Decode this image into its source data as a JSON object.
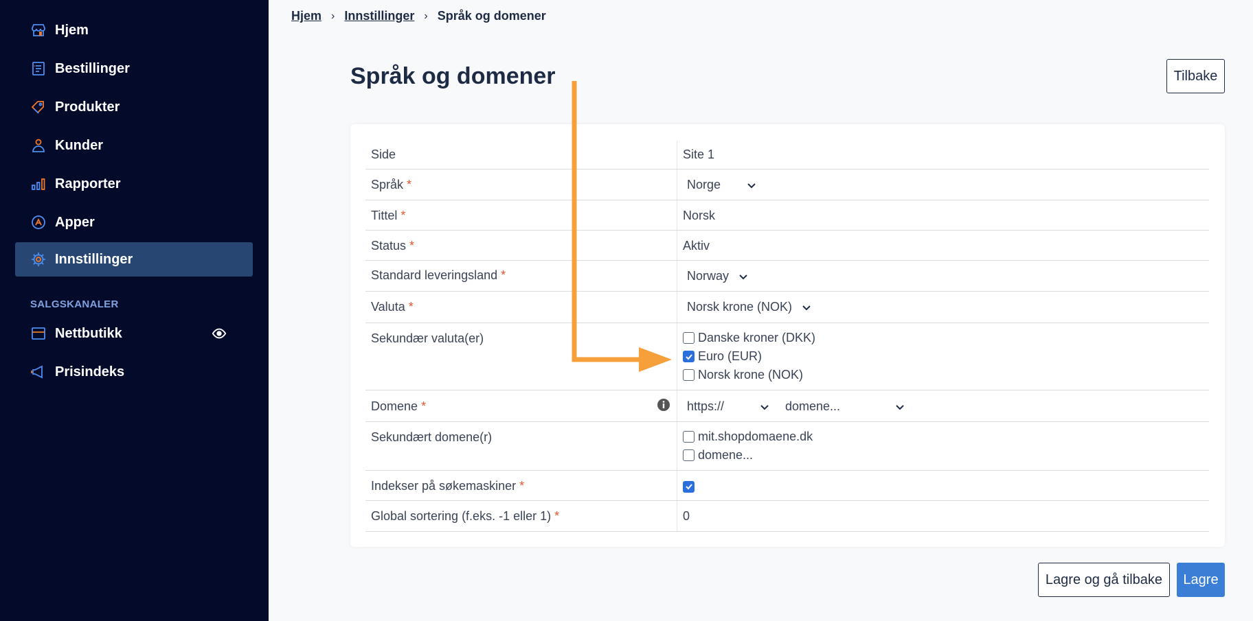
{
  "sidebar": {
    "items": [
      {
        "label": "Hjem",
        "icon": "store-icon"
      },
      {
        "label": "Bestillinger",
        "icon": "orders-icon"
      },
      {
        "label": "Produkter",
        "icon": "tag-icon"
      },
      {
        "label": "Kunder",
        "icon": "user-icon"
      },
      {
        "label": "Rapporter",
        "icon": "bar-chart-icon"
      },
      {
        "label": "Apper",
        "icon": "apps-icon"
      },
      {
        "label": "Innstillinger",
        "icon": "gear-icon",
        "active": true
      }
    ],
    "section_heading": "SALGSKANALER",
    "channels": [
      {
        "label": "Nettbutikk",
        "icon": "shop-icon"
      },
      {
        "label": "Prisindeks",
        "icon": "megaphone-icon"
      }
    ]
  },
  "breadcrumb": {
    "items": [
      "Hjem",
      "Innstillinger"
    ],
    "current": "Språk og domener"
  },
  "page": {
    "title": "Språk og domener",
    "back_label": "Tilbake",
    "save_back_label": "Lagre og gå tilbake",
    "save_label": "Lagre"
  },
  "form": {
    "side": {
      "label": "Side",
      "value": "Site 1"
    },
    "sprak": {
      "label": "Språk",
      "value": "Norge"
    },
    "tittel": {
      "label": "Tittel",
      "value": "Norsk"
    },
    "status": {
      "label": "Status",
      "value": "Aktiv"
    },
    "leveringsland": {
      "label": "Standard leveringsland",
      "value": "Norway"
    },
    "valuta": {
      "label": "Valuta",
      "value": "Norsk krone (NOK)"
    },
    "sekundar_valuta": {
      "label": "Sekundær valuta(er)",
      "options": [
        {
          "label": "Danske kroner (DKK)",
          "checked": false
        },
        {
          "label": "Euro (EUR)",
          "checked": true
        },
        {
          "label": "Norsk krone (NOK)",
          "checked": false
        }
      ]
    },
    "domene": {
      "label": "Domene",
      "protocol": "https://",
      "domain": "domene..."
    },
    "sekundart_domene": {
      "label": "Sekundært domene(r)",
      "options": [
        {
          "label": "mit.shopdomaene.dk",
          "checked": false
        },
        {
          "label": "domene...",
          "checked": false
        }
      ]
    },
    "indekser": {
      "label": "Indekser på søkemaskiner",
      "checked": true
    },
    "sortering": {
      "label": "Global sortering (f.eks. -1 eller 1)",
      "value": "0"
    },
    "required_mark": "*"
  },
  "colors": {
    "sidebar_bg": "#040a2a",
    "active_bg": "#274671",
    "accent": "#3b7ed6",
    "arrow": "#f5a03a",
    "required": "#e4572e"
  }
}
